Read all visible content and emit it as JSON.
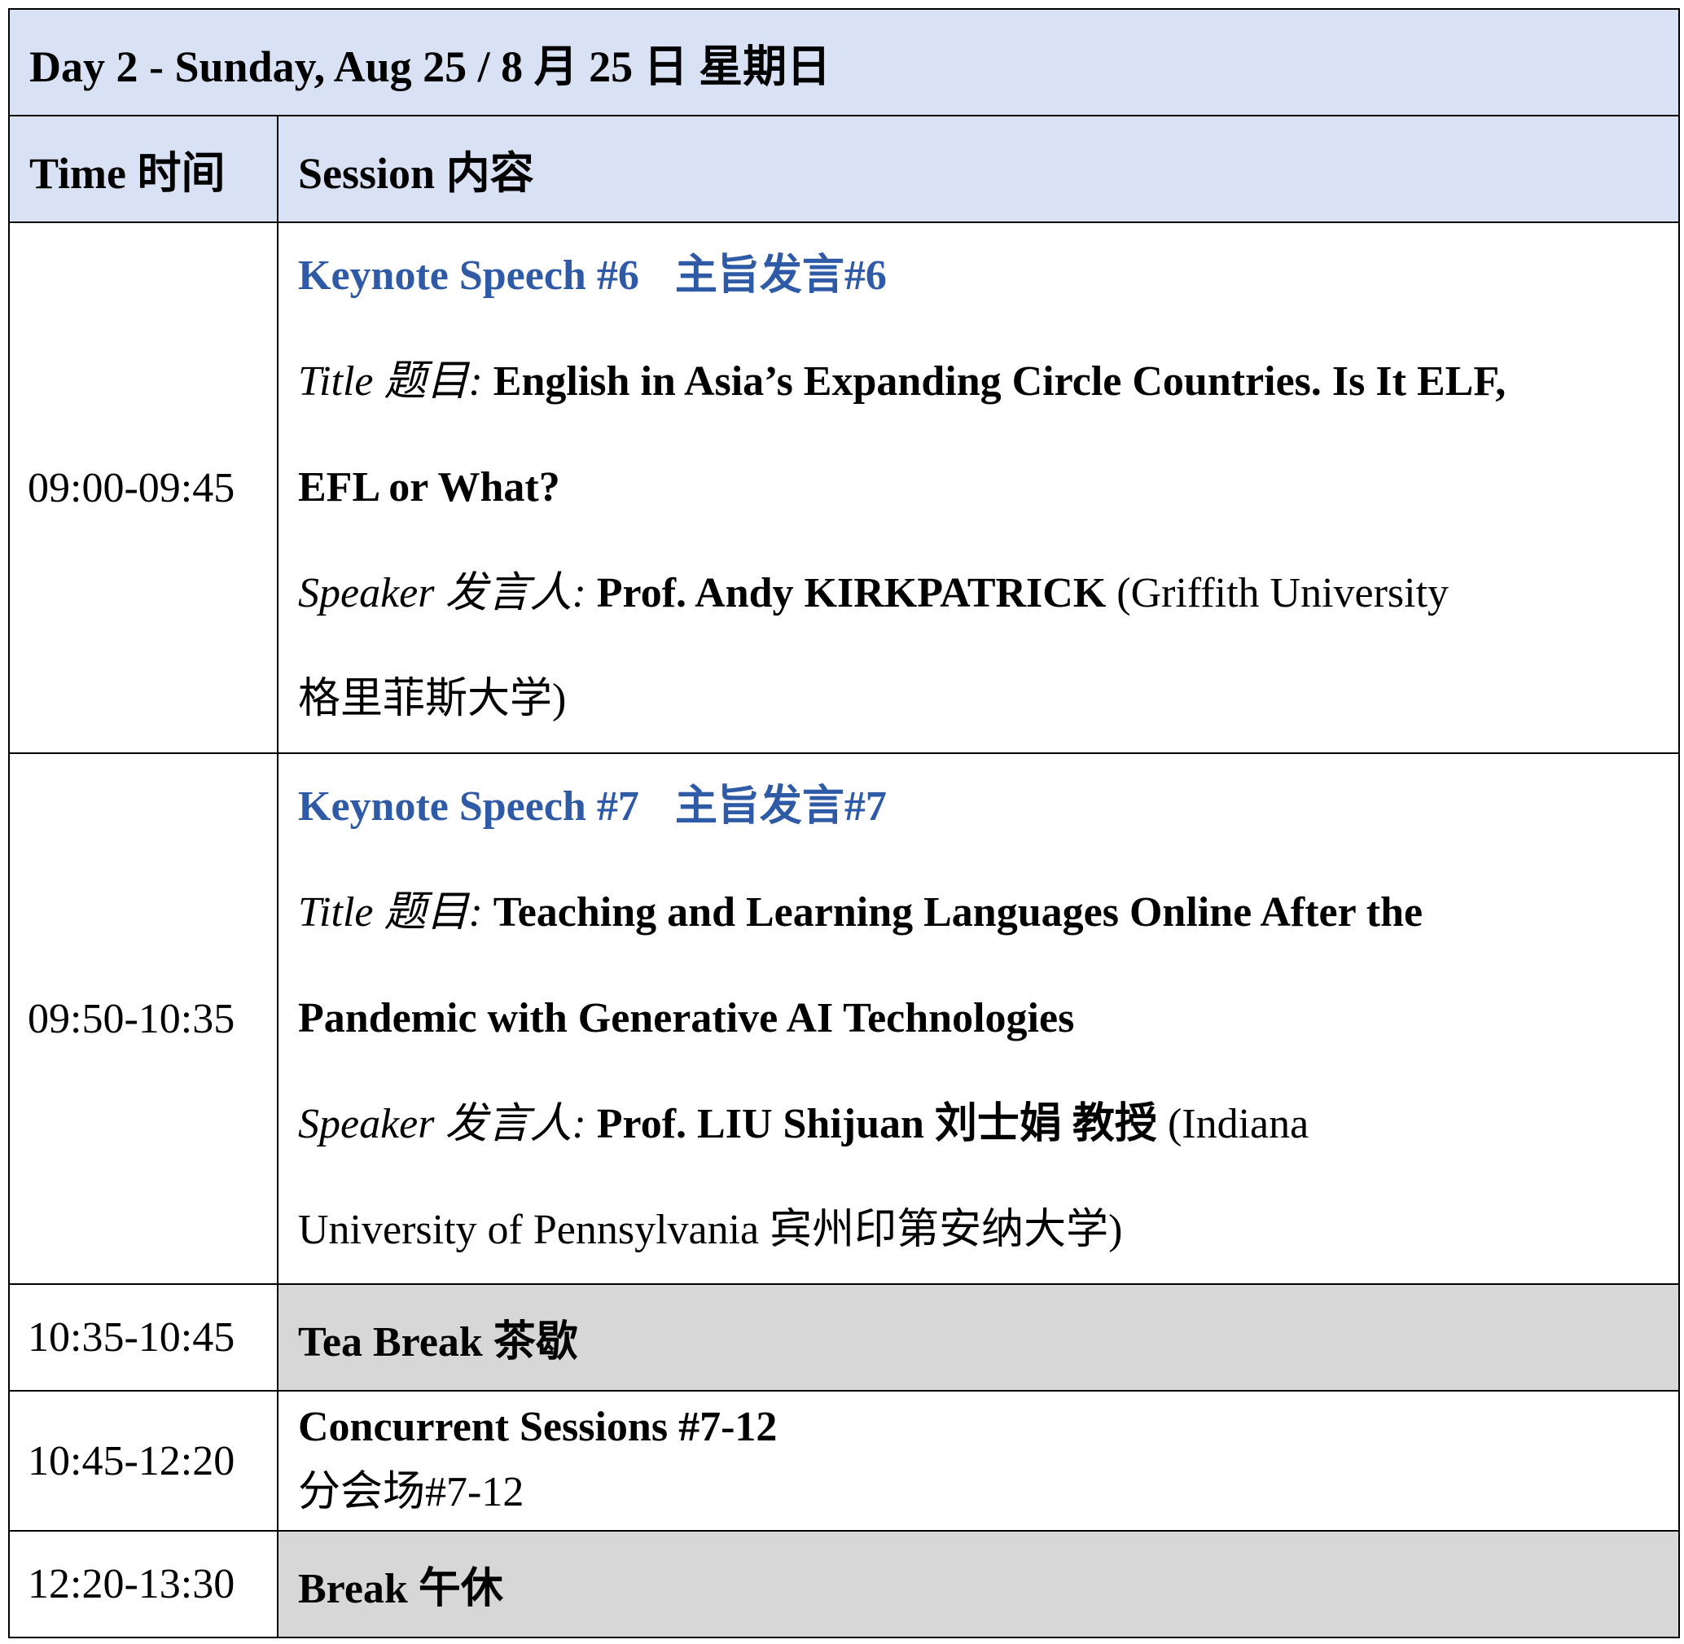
{
  "day_header": "Day 2 - Sunday, Aug 25 / 8 月 25 日  星期日",
  "columns": {
    "time": "Time  时间",
    "session": "Session  内容"
  },
  "rows": [
    {
      "time": "09:00-09:45",
      "heading_en": "Keynote Speech #6",
      "heading_zh": "主旨发言#6",
      "title_label": "Title 题目:",
      "title_text": "English in Asia’s Expanding Circle Countries. Is It ELF,",
      "title_text_cont": "EFL or What?",
      "speaker_label": "Speaker 发言人:",
      "speaker_name": "Prof. Andy KIRKPATRICK",
      "speaker_affil": "(Griffith University",
      "speaker_affil_cont": "格里菲斯大学)"
    },
    {
      "time": "09:50-10:35",
      "heading_en": "Keynote Speech #7",
      "heading_zh": "主旨发言#7",
      "title_label": "Title 题目:",
      "title_text": "Teaching and Learning Languages Online After the",
      "title_text_cont": "Pandemic with Generative AI Technologies",
      "speaker_label": "Speaker 发言人:",
      "speaker_name": "Prof. LIU Shijuan  刘士娟  教授",
      "speaker_affil": "(Indiana",
      "speaker_affil_cont": "University of Pennsylvania  宾州印第安纳大学)"
    },
    {
      "time": "10:35-10:45",
      "session": "Tea Break  茶歇"
    },
    {
      "time": "10:45-12:20",
      "session_en": "Concurrent Sessions #7-12",
      "session_zh": "分会场#7-12"
    },
    {
      "time": "12:20-13:30",
      "session": "Break  午休"
    }
  ],
  "colors": {
    "header_bg": "#d9e1f4",
    "keynote_heading": "#2f5aa6",
    "break_bg": "#d7d7d7"
  }
}
